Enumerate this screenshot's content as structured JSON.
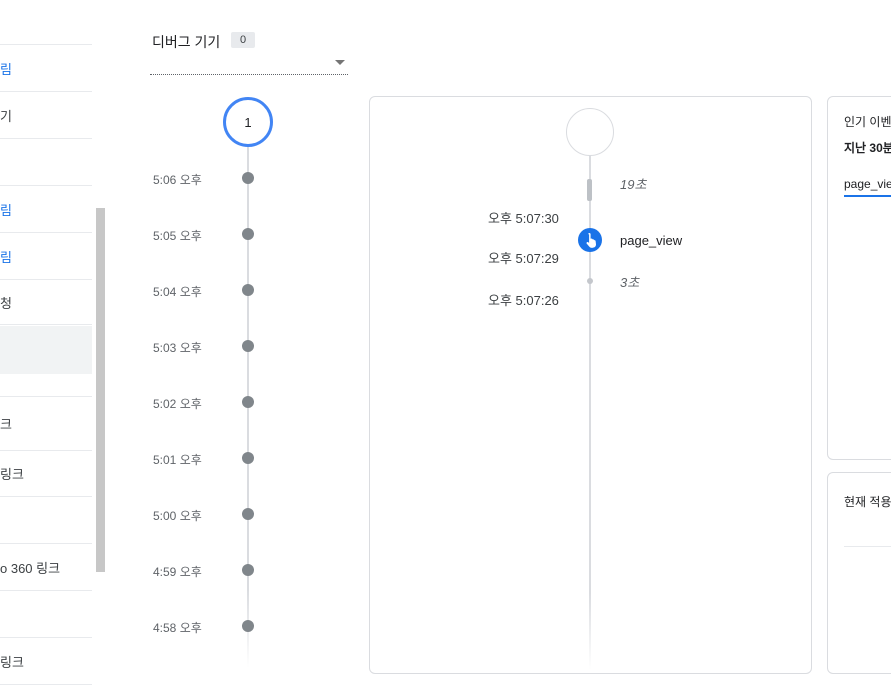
{
  "sidebar": {
    "items": [
      {
        "label": "",
        "top": 0
      },
      {
        "label": "림",
        "style": "blue"
      },
      {
        "label": "기",
        "style": "normal"
      },
      {
        "label": "",
        "style": "normal"
      },
      {
        "label": "림",
        "style": "blue"
      },
      {
        "label": "림",
        "style": "blue"
      },
      {
        "label": "청",
        "style": "normal"
      },
      {
        "label": "",
        "style": "active"
      },
      {
        "label": "크",
        "style": "normal"
      },
      {
        "label": "링크",
        "style": "normal"
      },
      {
        "label": "",
        "style": "normal"
      },
      {
        "label": "o 360 링크",
        "style": "normal"
      },
      {
        "label": "",
        "style": "normal"
      },
      {
        "label": "링크",
        "style": "normal"
      }
    ]
  },
  "device": {
    "label": "디버그 기기",
    "count": "0"
  },
  "minutes": {
    "current_count": "1",
    "labels": [
      "5:06 오후",
      "5:05 오후",
      "5:04 오후",
      "5:03 오후",
      "5:02 오후",
      "5:01 오후",
      "5:00 오후",
      "4:59 오후",
      "4:58 오후"
    ]
  },
  "seconds": {
    "gap_top": "19초",
    "time_1": "오후 5:07:30",
    "event_name": "page_view",
    "time_2": "오후 5:07:29",
    "gap_bottom": "3초",
    "time_3": "오후 5:07:26"
  },
  "top_events_card": {
    "title": "인기 이벤트",
    "subtitle": "지난 30분",
    "tab": "page_view"
  },
  "user_props_card": {
    "title": "현재 적용"
  },
  "colors": {
    "accent": "#1a73e8",
    "minute_circle_border": "#4285f4",
    "dot": "#80868b"
  },
  "icons": {
    "event": "touch-icon",
    "dropdown": "chevron-down-icon"
  }
}
